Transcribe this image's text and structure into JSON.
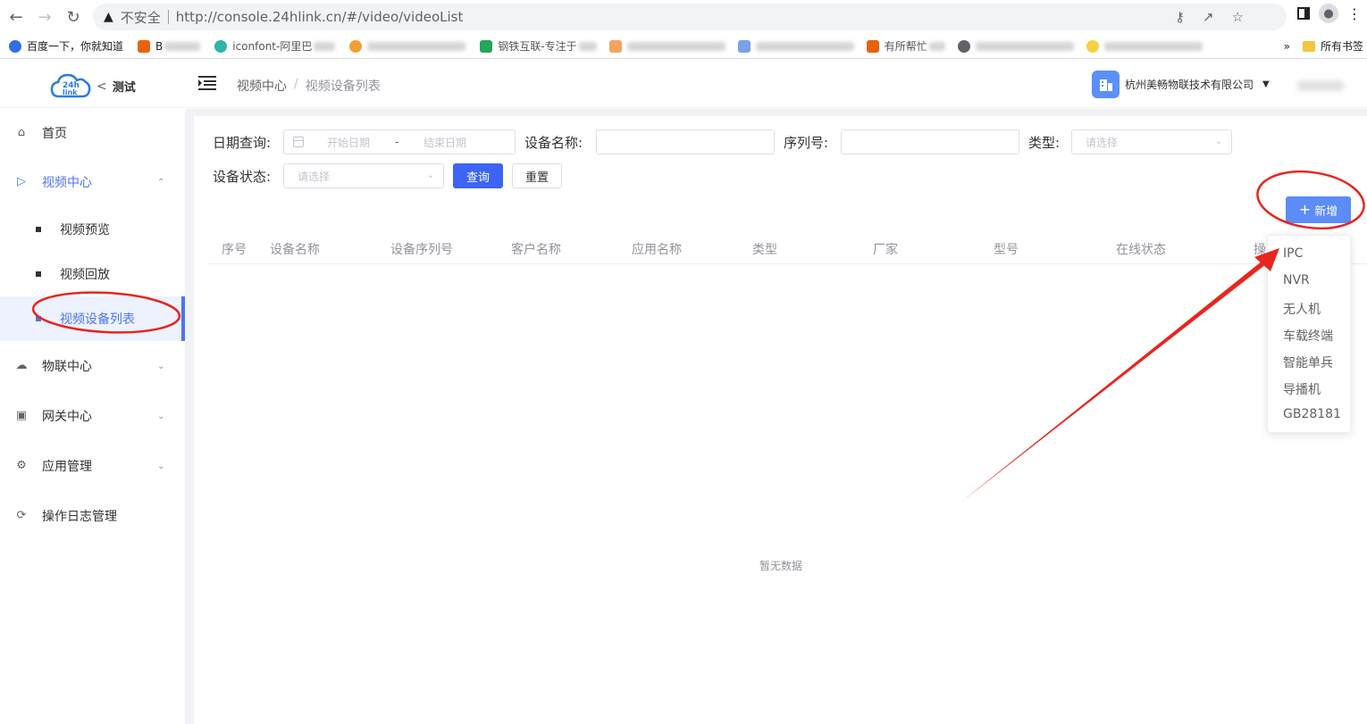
{
  "browser": {
    "security_label": "不安全",
    "url": "http://console.24hlink.cn/#/video/videoList",
    "bookmarks": [
      {
        "label": "百度一下，你就知道",
        "color": "#3070e6"
      },
      {
        "label": "B",
        "color": "#e8620c"
      },
      {
        "label": "iconfont-阿里巴",
        "color": "#2fb5a5"
      },
      {
        "label": "",
        "color": "#f0a030"
      },
      {
        "label": "",
        "color": "#c9c9c9"
      },
      {
        "label": "钢铁互联-专注于",
        "color": "#26a65b"
      },
      {
        "label": "",
        "color": "#f4a460"
      },
      {
        "label": "",
        "color": "#7aa1e8"
      },
      {
        "label": "有所帮忙",
        "color": "#e8620c"
      },
      {
        "label": "",
        "color": "#5f6368"
      },
      {
        "label": "",
        "color": "#f5d142"
      }
    ],
    "all_bookmarks": "所有书签",
    "more": "»"
  },
  "header": {
    "logo_text": "24h link",
    "project": "测试",
    "breadcrumb": [
      "视频中心",
      "视频设备列表"
    ],
    "company": "杭州美畅物联技术有限公司"
  },
  "sidebar": {
    "items": [
      {
        "label": "首页",
        "icon": "home-icon"
      },
      {
        "label": "视频中心",
        "icon": "video-icon",
        "expanded": true,
        "children": [
          "视频预览",
          "视频回放",
          "视频设备列表"
        ]
      },
      {
        "label": "物联中心",
        "icon": "iot-icon"
      },
      {
        "label": "网关中心",
        "icon": "gateway-icon"
      },
      {
        "label": "应用管理",
        "icon": "settings-icon"
      },
      {
        "label": "操作日志管理",
        "icon": "log-icon"
      }
    ],
    "selected": "视频设备列表"
  },
  "filters": {
    "date_label": "日期查询:",
    "start_placeholder": "开始日期",
    "range_sep": "-",
    "end_placeholder": "结束日期",
    "device_name_label": "设备名称:",
    "serial_label": "序列号:",
    "type_label": "类型:",
    "type_placeholder": "请选择",
    "status_label": "设备状态:",
    "status_placeholder": "请选择",
    "query_button": "查询",
    "reset_button": "重置"
  },
  "add_button": "新增",
  "table": {
    "columns": [
      "序号",
      "设备名称",
      "设备序列号",
      "客户名称",
      "应用名称",
      "类型",
      "厂家",
      "型号",
      "在线状态",
      "操"
    ],
    "empty_text": "暂无数据"
  },
  "add_menu": [
    "IPC",
    "NVR",
    "无人机",
    "车载终端",
    "智能单兵",
    "导播机",
    "GB28181"
  ],
  "colors": {
    "primary": "#3c64f5",
    "annotation": "#e8261e",
    "sidebar_active": "#4a74f5"
  }
}
